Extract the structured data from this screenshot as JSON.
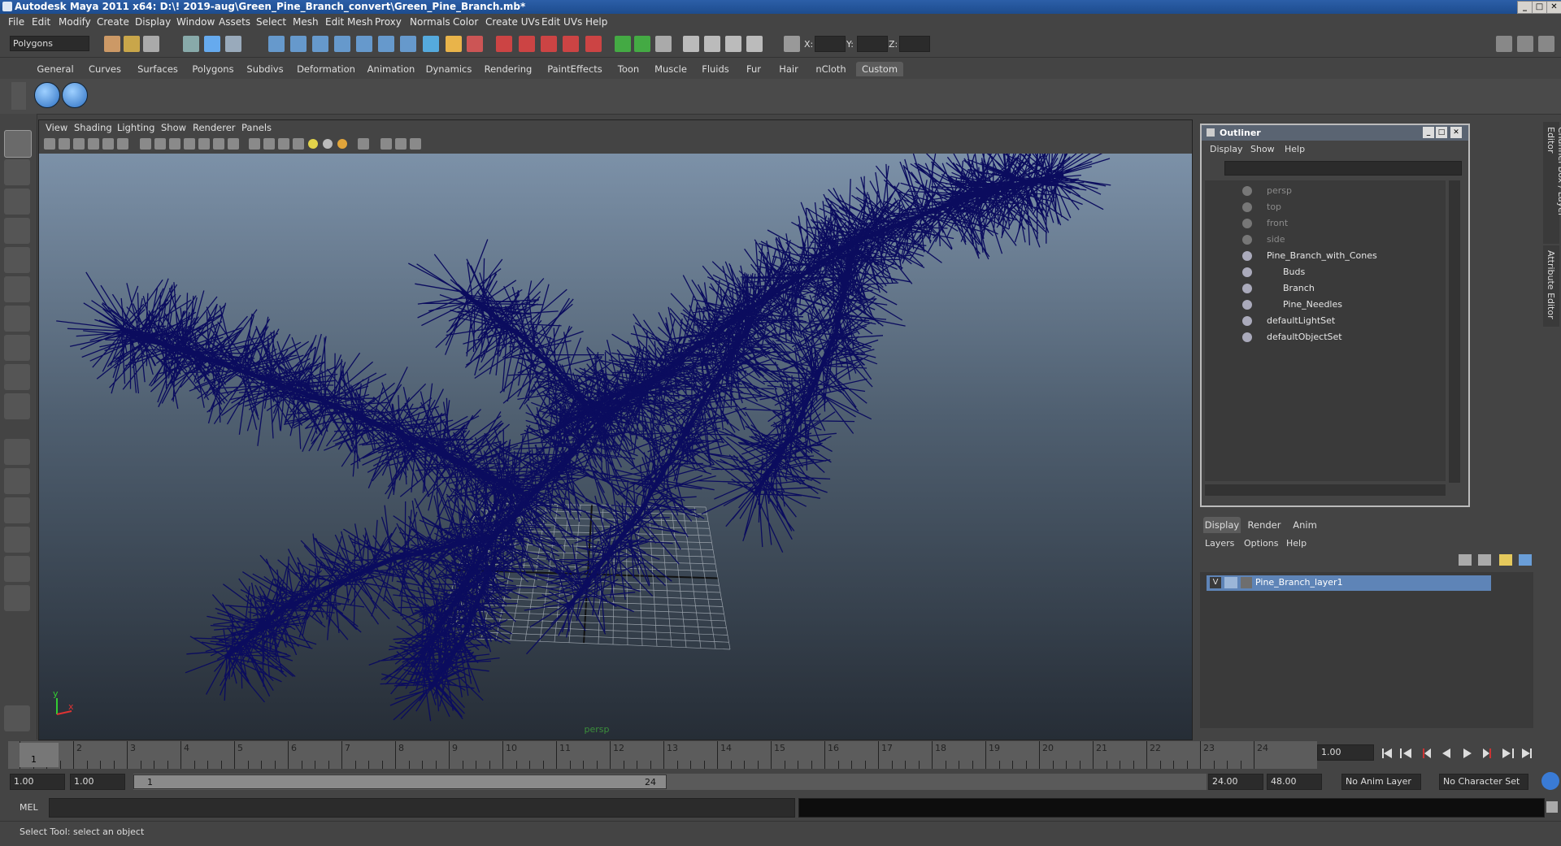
{
  "title": "Autodesk Maya 2011 x64: D:\\! 2019-aug\\Green_Pine_Branch_convert\\Green_Pine_Branch.mb*",
  "menu": [
    "File",
    "Edit",
    "Modify",
    "Create",
    "Display",
    "Window",
    "Assets",
    "Select",
    "Mesh",
    "Edit Mesh",
    "Proxy",
    "Normals",
    "Color",
    "Create UVs",
    "Edit UVs",
    "Help"
  ],
  "status": {
    "mode": "Polygons",
    "x_label": "X:",
    "y_label": "Y:",
    "z_label": "Z:"
  },
  "shelf_tabs": [
    "General",
    "Curves",
    "Surfaces",
    "Polygons",
    "Subdivs",
    "Deformation",
    "Animation",
    "Dynamics",
    "Rendering",
    "PaintEffects",
    "Toon",
    "Muscle",
    "Fluids",
    "Fur",
    "Hair",
    "nCloth",
    "Custom"
  ],
  "active_shelf": "Custom",
  "viewport": {
    "menu": [
      "View",
      "Shading",
      "Lighting",
      "Show",
      "Renderer",
      "Panels"
    ],
    "camera": "persp",
    "axis_y": "y",
    "axis_x": "x"
  },
  "outliner": {
    "title": "Outliner",
    "menu": [
      "Display",
      "Show",
      "Help"
    ],
    "items": [
      {
        "label": "persp",
        "dim": true,
        "indent": 0
      },
      {
        "label": "top",
        "dim": true,
        "indent": 0
      },
      {
        "label": "front",
        "dim": true,
        "indent": 0
      },
      {
        "label": "side",
        "dim": true,
        "indent": 0
      },
      {
        "label": "Pine_Branch_with_Cones",
        "dim": false,
        "indent": 0
      },
      {
        "label": "Buds",
        "dim": false,
        "indent": 1
      },
      {
        "label": "Branch",
        "dim": false,
        "indent": 1
      },
      {
        "label": "Pine_Needles",
        "dim": false,
        "indent": 1
      },
      {
        "label": "defaultLightSet",
        "dim": false,
        "indent": 0
      },
      {
        "label": "defaultObjectSet",
        "dim": false,
        "indent": 0
      }
    ]
  },
  "side_tabs": [
    "Channel Box / Layer Editor",
    "Attribute Editor"
  ],
  "layers": {
    "tabs": [
      "Display",
      "Render",
      "Anim"
    ],
    "menu": [
      "Layers",
      "Options",
      "Help"
    ],
    "row": {
      "visibility": "V",
      "name": "Pine_Branch_layer1"
    }
  },
  "timeline": {
    "ticks": [
      "1",
      "2",
      "3",
      "4",
      "5",
      "6",
      "7",
      "8",
      "9",
      "10",
      "11",
      "12",
      "13",
      "14",
      "15",
      "16",
      "17",
      "18",
      "19",
      "20",
      "21",
      "22",
      "23",
      "24"
    ],
    "current_frame": "1",
    "current_time": "1.00"
  },
  "range": {
    "start": "1.00",
    "playback_start": "1.00",
    "slider_start": "1",
    "slider_end": "24",
    "playback_end": "24.00",
    "end": "48.00",
    "anim_layer": "No Anim Layer",
    "character_set": "No Character Set"
  },
  "cmd": {
    "label": "MEL"
  },
  "help": "Select Tool: select an object",
  "colors": {
    "needles": "#0b0c5e",
    "layer_select": "#5e84b7",
    "title": "#2c5fa8"
  }
}
